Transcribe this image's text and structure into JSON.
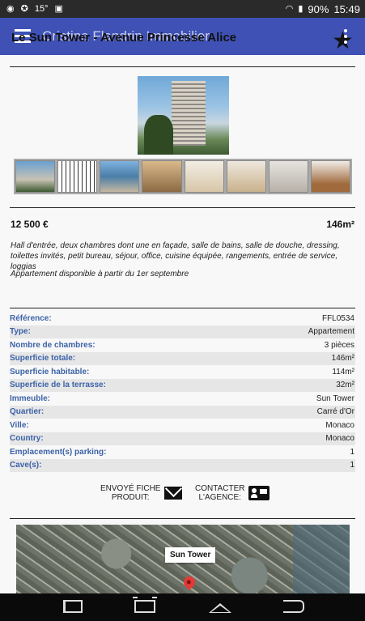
{
  "status_bar": {
    "battery": "90%",
    "time": "15:49",
    "left_text": "15°"
  },
  "app_bar": {
    "app_title": "Cristina Flandrin Immobilier",
    "page_title": "Le Sun Tower - Avenue Princesse Alice",
    "favorite_icon": "star-icon"
  },
  "listing": {
    "price": "12 500 €",
    "area": "146m²",
    "description": "Hall d'entrée, deux chambres dont une en façade, salle de bains, salle de douche, dressing, toilettes invités, petit bureau, séjour, office, cuisine équipée, rangements, entrée de service, loggias",
    "availability": "Appartement disponible à partir du 1er septembre",
    "thumbnail_count": 8
  },
  "specs": [
    {
      "key": "Référence:",
      "value": "FFL0534"
    },
    {
      "key": "Type:",
      "value": "Appartement"
    },
    {
      "key": "Nombre de chambres:",
      "value": "3 pièces"
    },
    {
      "key": "Superficie totale:",
      "value": "146m²"
    },
    {
      "key": "Superficie habitable:",
      "value": "114m²"
    },
    {
      "key": "Superficie de la terrasse:",
      "value": "32m²"
    },
    {
      "key": "Immeuble:",
      "value": "Sun Tower"
    },
    {
      "key": "Quartier:",
      "value": "Carré d'Or"
    },
    {
      "key": "Ville:",
      "value": "Monaco"
    },
    {
      "key": "Country:",
      "value": "Monaco"
    },
    {
      "key": "Emplacement(s) parking:",
      "value": "1"
    },
    {
      "key": "Cave(s):",
      "value": "1"
    }
  ],
  "actions": {
    "send_line1": "ENVOYÉ FICHE",
    "send_line2": "PRODUIT:",
    "contact_line1": "CONTACTER",
    "contact_line2": "L'AGENCE:"
  },
  "map": {
    "marker_label": "Sun Tower"
  }
}
